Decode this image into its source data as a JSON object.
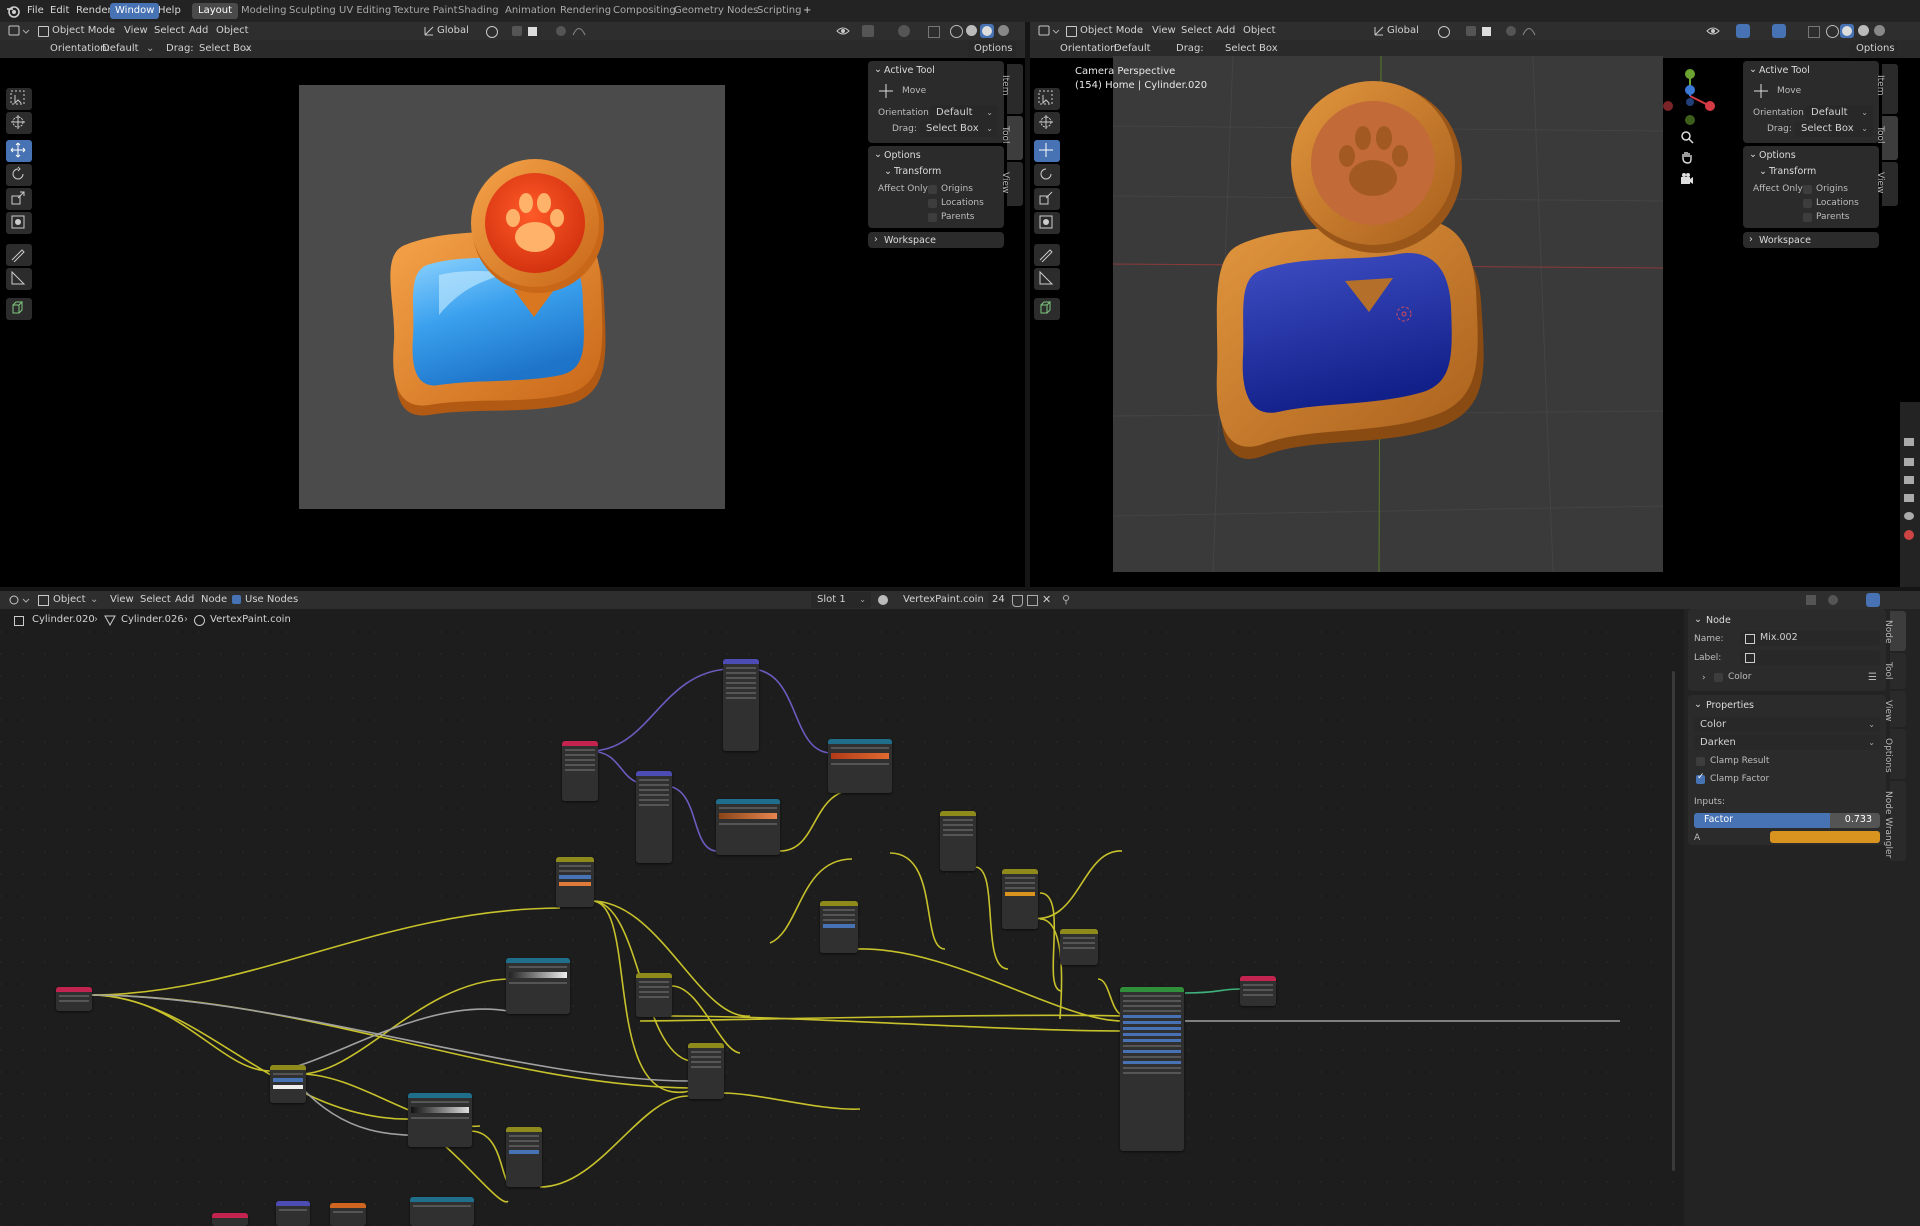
{
  "menubar": {
    "items": [
      "File",
      "Edit",
      "Render",
      "Window",
      "Help"
    ],
    "active_item": "Window",
    "workspace_tabs": [
      "Layout",
      "Modeling",
      "Sculpting",
      "UV Editing",
      "Texture Paint",
      "Shading",
      "Animation",
      "Rendering",
      "Compositing",
      "Geometry Nodes",
      "Scripting"
    ],
    "active_tab": "Layout",
    "add_tab": "+"
  },
  "viewport_left": {
    "mode": "Object Mode",
    "menus": [
      "View",
      "Select",
      "Add",
      "Object"
    ],
    "transform_orientation": "Global",
    "orientation_label": "Orientation:",
    "orientation_value": "Default",
    "drag_label": "Drag:",
    "drag_value": "Select Box",
    "options": "Options",
    "side_tabs": [
      "Item",
      "Tool",
      "View"
    ]
  },
  "viewport_right": {
    "mode": "Object Mode",
    "menus": [
      "View",
      "Select",
      "Add",
      "Object"
    ],
    "transform_orientation": "Global",
    "orientation_label": "Orientation:",
    "orientation_value": "Default",
    "drag_label": "Drag:",
    "drag_value": "Select Box",
    "options": "Options",
    "camera_title": "Camera Perspective",
    "camera_subtitle": "(154) Home | Cylinder.020",
    "side_tabs": [
      "Item",
      "Tool",
      "View"
    ]
  },
  "tool_panel": {
    "active_tool": "Active Tool",
    "move": "Move",
    "orientation_label": "Orientation",
    "orientation_value": "Default",
    "drag_label": "Drag:",
    "drag_value": "Select Box",
    "options": "Options",
    "transform": "Transform",
    "affect_only": "Affect Only",
    "origins": "Origins",
    "locations": "Locations",
    "parents": "Parents",
    "workspace": "Workspace"
  },
  "node_editor": {
    "type": "Object",
    "menus": [
      "View",
      "Select",
      "Add",
      "Node"
    ],
    "use_nodes": "Use Nodes",
    "slot": "Slot 1",
    "material": "VertexPaint.coin",
    "users": "24",
    "breadcrumb": [
      "Cylinder.020",
      "Cylinder.026",
      "VertexPaint.coin"
    ]
  },
  "node_sidebar": {
    "node_title": "Node",
    "name_label": "Name:",
    "name_value": "Mix.002",
    "label_label": "Label:",
    "color_label": "Color",
    "properties_title": "Properties",
    "data_type": "Color",
    "blend_mode": "Darken",
    "clamp_result": "Clamp Result",
    "clamp_factor": "Clamp Factor",
    "inputs_label": "Inputs:",
    "factor_label": "Factor",
    "factor_value": "0.733",
    "factor_fraction": 0.733,
    "a_label": "A",
    "a_color": "#d9931f",
    "tabs": [
      "Node",
      "Tool",
      "View",
      "Options",
      "Node Wrangler"
    ]
  },
  "colors": {
    "accent": "#4772b3",
    "wire_yellow": "#c7c12b",
    "wire_purple": "#6b5cc0",
    "wire_gray": "#a1a1a1",
    "wire_green": "#3fb27b"
  }
}
